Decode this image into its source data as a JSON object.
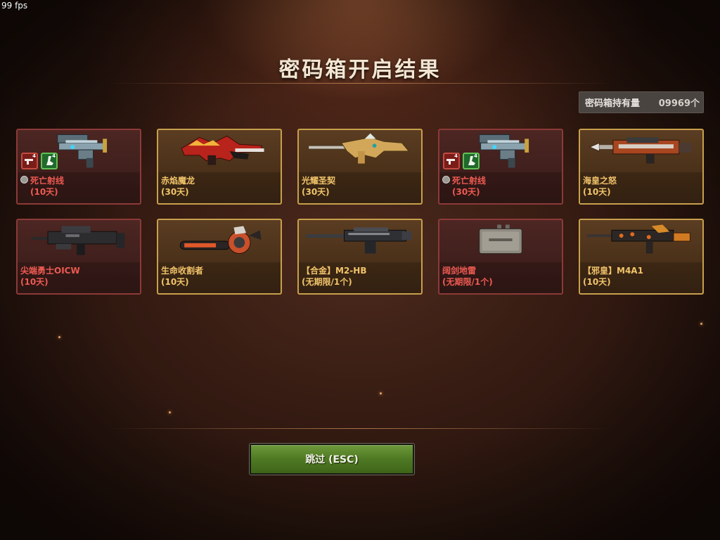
{
  "fps": "99 fps",
  "title": "密码箱开启结果",
  "holdings": {
    "label": "密码箱持有量",
    "value": "09969个"
  },
  "items": [
    {
      "name": "死亡射线",
      "duration": "(10天)",
      "rarity": "red",
      "weapon": "death-ray",
      "badges": [
        "red-pistol-icon",
        "green-boot-icon"
      ]
    },
    {
      "name": "赤焰魔龙",
      "duration": "(30天)",
      "rarity": "gold",
      "weapon": "dragon-rifle"
    },
    {
      "name": "光耀圣契",
      "duration": "(30天)",
      "rarity": "gold",
      "weapon": "gold-rifle"
    },
    {
      "name": "死亡射线",
      "duration": "(30天)",
      "rarity": "red",
      "weapon": "death-ray",
      "badges": [
        "red-pistol-icon",
        "green-boot-icon"
      ]
    },
    {
      "name": "海皇之怒",
      "duration": "(10天)",
      "rarity": "gold",
      "weapon": "trident-gun"
    },
    {
      "name": "尖端勇士OICW",
      "duration": "(10天)",
      "rarity": "red",
      "weapon": "oicw-rifle"
    },
    {
      "name": "生命收割者",
      "duration": "(10天)",
      "rarity": "gold",
      "weapon": "chainsaw"
    },
    {
      "name": "【合金】M2-HB",
      "duration": "(无期限/1个)",
      "rarity": "gold",
      "weapon": "heavy-mg"
    },
    {
      "name": "阔剑地雷",
      "duration": "(无期限/1个)",
      "rarity": "red",
      "weapon": "claymore-mine"
    },
    {
      "name": "【邪皇】M4A1",
      "duration": "(10天)",
      "rarity": "gold",
      "weapon": "m4a1-rifle"
    }
  ],
  "skip_button": "跳过 (ESC)"
}
